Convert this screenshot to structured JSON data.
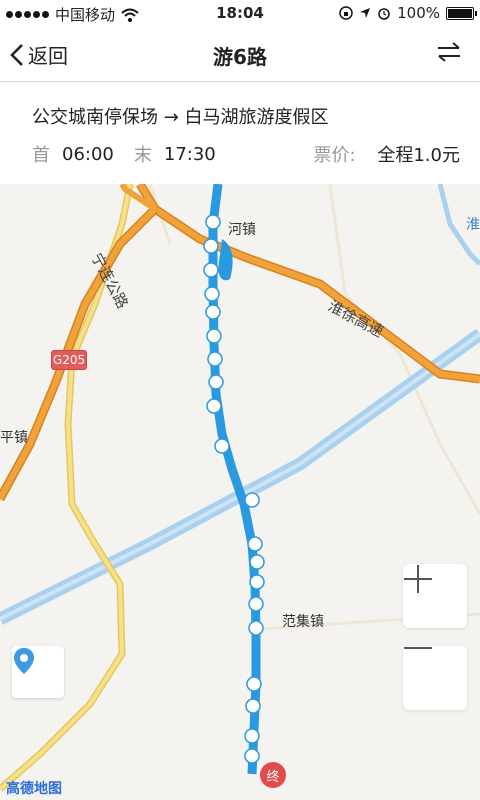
{
  "status_bar": {
    "carrier": "中国移动",
    "time": "18:04",
    "battery": "100%"
  },
  "nav": {
    "back_label": "返回",
    "title": "游6路"
  },
  "info": {
    "route": "公交城南停保场 → 白马湖旅游度假区",
    "first_label": "首",
    "first_time": "06:00",
    "last_label": "末",
    "last_time": "17:30",
    "fare_label": "票价:",
    "fare_value": "全程1.0元"
  },
  "map": {
    "labels": {
      "town_top": "河镇",
      "road_ning": "宁连公路",
      "highway": "淮徐高速",
      "road_badge": "G205",
      "town_left": "平镇",
      "town_fanji": "范集镇",
      "edge": "淮"
    },
    "end_badge": "终",
    "logo": "高德地图"
  },
  "colors": {
    "route_line": "#2a9ae0",
    "highway": "#e9912c",
    "road_yellow": "#f1d774",
    "water": "#a8d0ef",
    "end_badge": "#e24b4b"
  }
}
